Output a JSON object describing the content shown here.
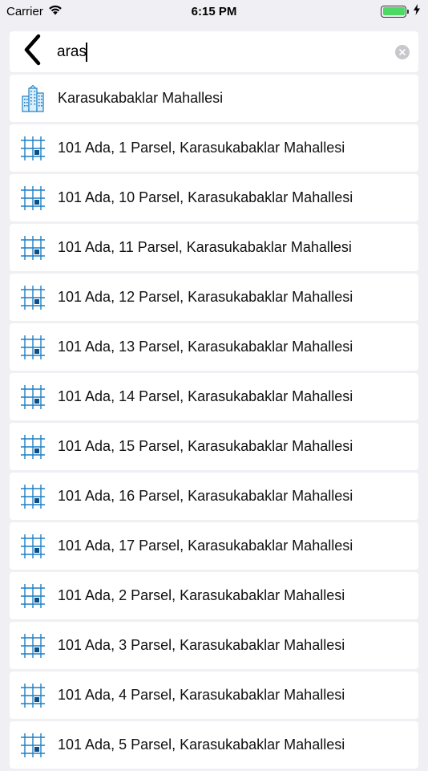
{
  "status_bar": {
    "carrier": "Carrier",
    "time": "6:15 PM",
    "icons": [
      "wifi-icon",
      "battery-icon",
      "charging-bolt-icon"
    ]
  },
  "search": {
    "value": "aras",
    "back_icon": "chevron-left-icon",
    "clear_icon": "clear-icon"
  },
  "colors": {
    "accent": "#1e7fc4",
    "accent_dark": "#0a4f8a",
    "background": "#efeff4",
    "battery": "#4cd964"
  },
  "results": [
    {
      "label": "Karasukabaklar Mahallesi",
      "icon": "buildings-icon"
    },
    {
      "label": "101 Ada, 1 Parsel, Karasukabaklar Mahallesi",
      "icon": "parcel-grid-icon"
    },
    {
      "label": "101 Ada, 10 Parsel, Karasukabaklar Mahallesi",
      "icon": "parcel-grid-icon"
    },
    {
      "label": "101 Ada, 11 Parsel, Karasukabaklar Mahallesi",
      "icon": "parcel-grid-icon"
    },
    {
      "label": "101 Ada, 12 Parsel, Karasukabaklar Mahallesi",
      "icon": "parcel-grid-icon"
    },
    {
      "label": "101 Ada, 13 Parsel, Karasukabaklar Mahallesi",
      "icon": "parcel-grid-icon"
    },
    {
      "label": "101 Ada, 14 Parsel, Karasukabaklar Mahallesi",
      "icon": "parcel-grid-icon"
    },
    {
      "label": "101 Ada, 15 Parsel, Karasukabaklar Mahallesi",
      "icon": "parcel-grid-icon"
    },
    {
      "label": "101 Ada, 16 Parsel, Karasukabaklar Mahallesi",
      "icon": "parcel-grid-icon"
    },
    {
      "label": "101 Ada, 17 Parsel, Karasukabaklar Mahallesi",
      "icon": "parcel-grid-icon"
    },
    {
      "label": "101 Ada, 2 Parsel, Karasukabaklar Mahallesi",
      "icon": "parcel-grid-icon"
    },
    {
      "label": "101 Ada, 3 Parsel, Karasukabaklar Mahallesi",
      "icon": "parcel-grid-icon"
    },
    {
      "label": "101 Ada, 4 Parsel, Karasukabaklar Mahallesi",
      "icon": "parcel-grid-icon"
    },
    {
      "label": "101 Ada, 5 Parsel, Karasukabaklar Mahallesi",
      "icon": "parcel-grid-icon"
    }
  ]
}
